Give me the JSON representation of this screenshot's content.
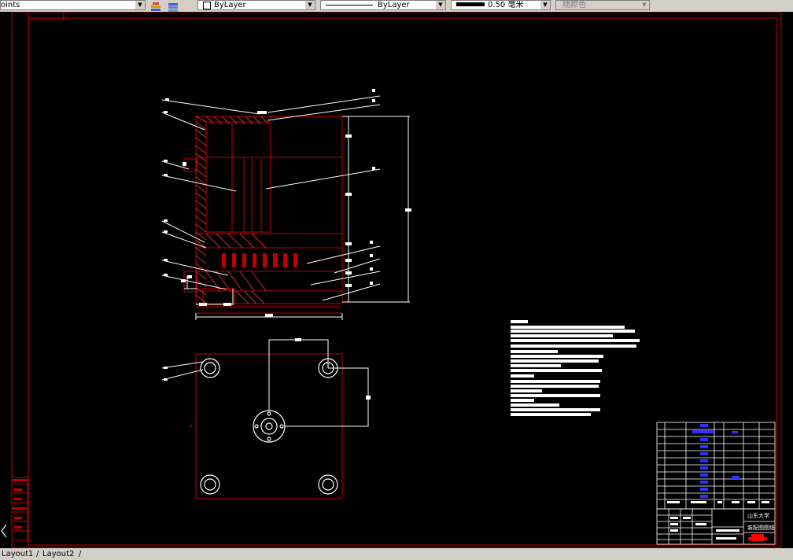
{
  "toolbar": {
    "points_label": "oints",
    "layer_select": "ByLayer",
    "linetype_select": "ByLayer",
    "lineweight_value": "0.50",
    "lineweight_unit": "毫米",
    "plotstyle_select": "随颜色"
  },
  "title_block": {
    "school": "山东大学",
    "drawing_name": "装配图图纸"
  },
  "layout_tabs": [
    "Layout1",
    "Layout2"
  ],
  "colors": {
    "background": "#000000",
    "border": "#c00000",
    "lines": "#ffffff",
    "highlight": "#ff0000",
    "bom_fill": "#3030ff"
  },
  "icons": [
    "layers-icon",
    "layer-stack-icon",
    "nav-left-icon"
  ]
}
